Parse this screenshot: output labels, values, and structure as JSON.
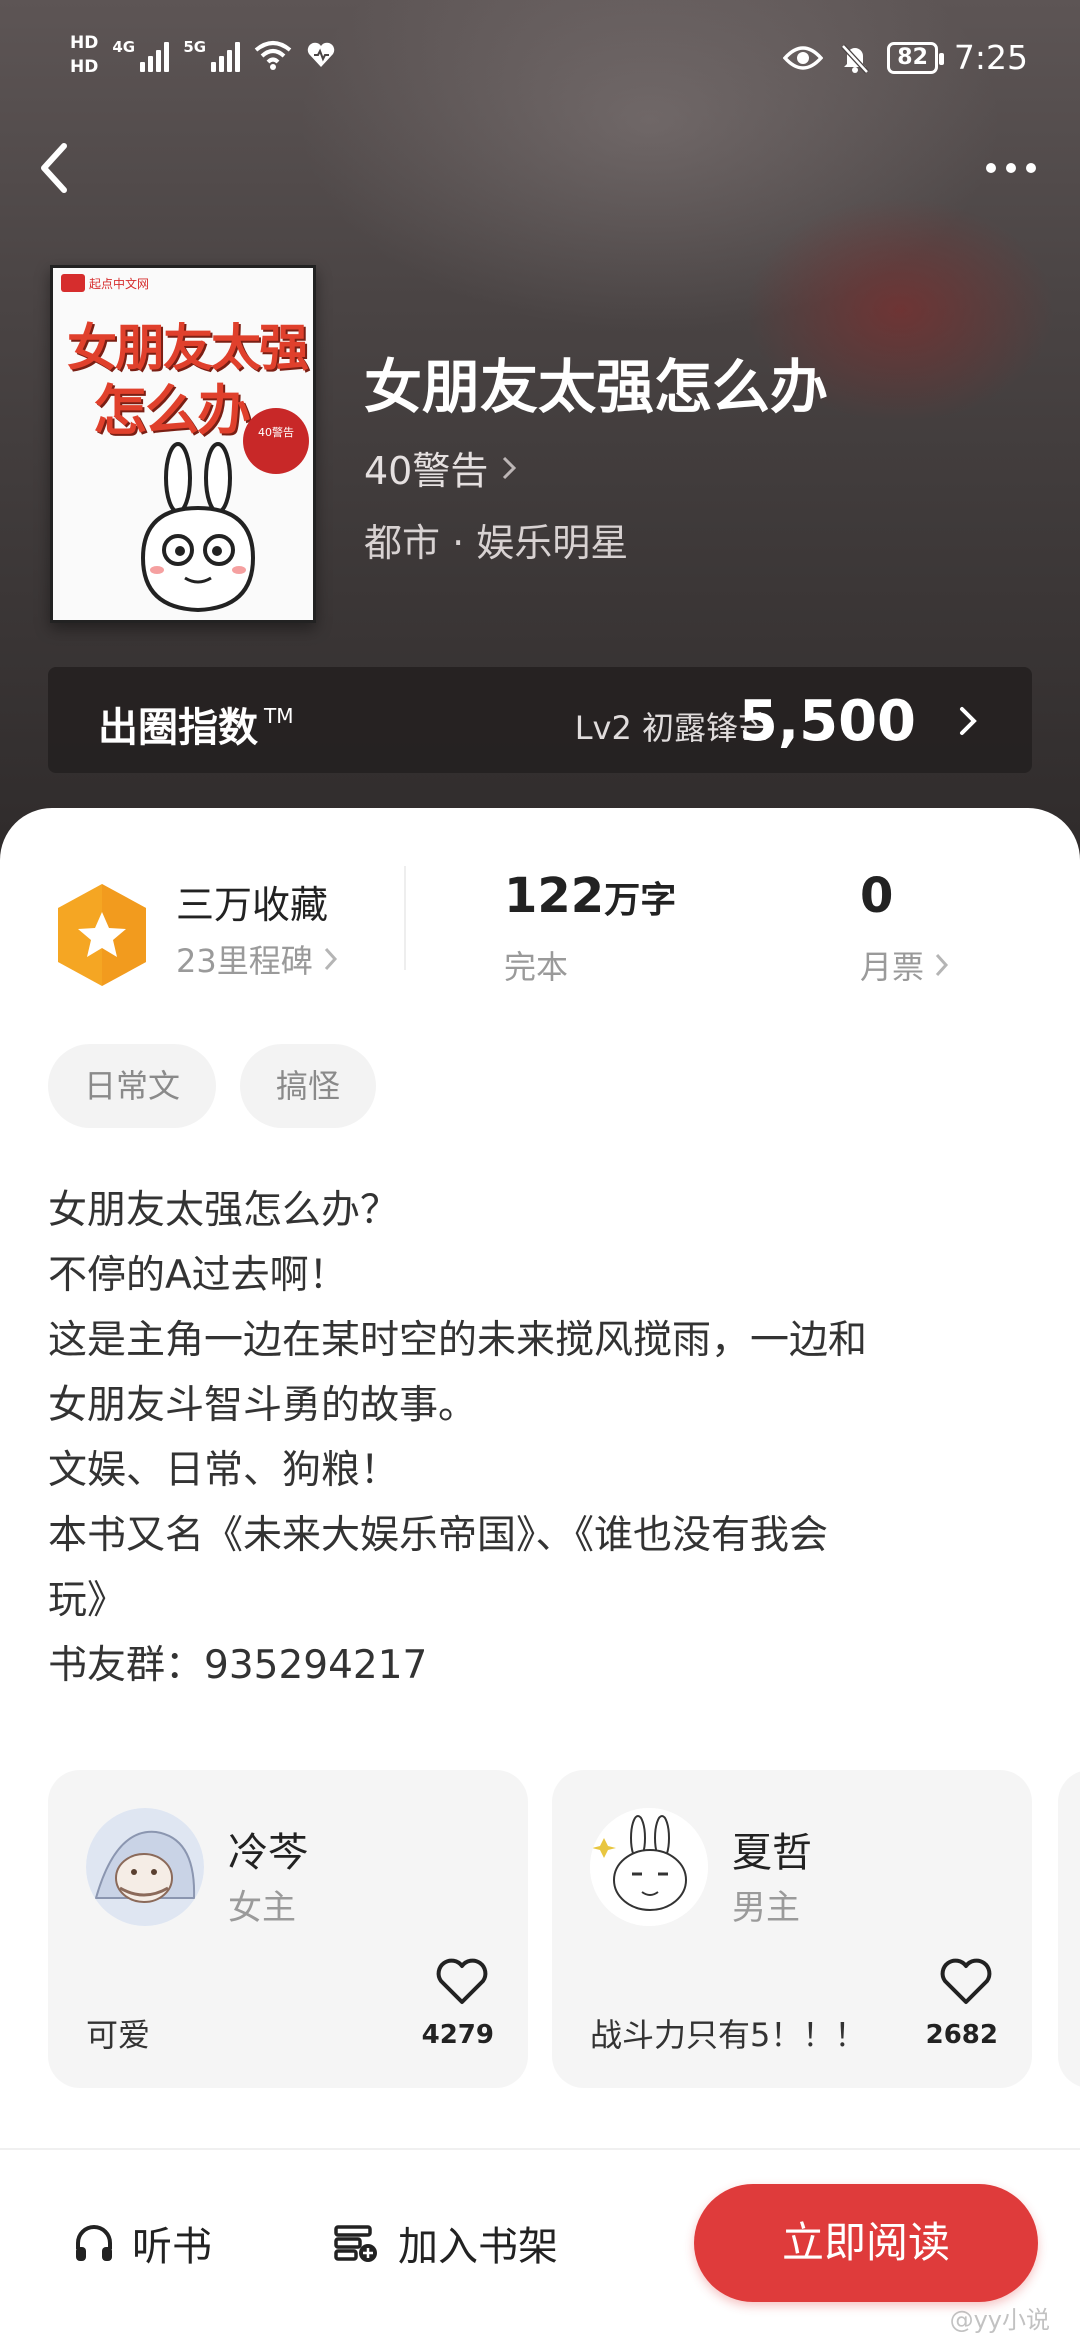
{
  "status_bar": {
    "hd1": "HD",
    "hd2": "HD",
    "net1": "4G",
    "net2": "5G",
    "battery": "82",
    "time": "7:25"
  },
  "book": {
    "title": "女朋友太强怎么办",
    "author": "40警告",
    "genre": "都市 · 娱乐明星",
    "cover": {
      "publisher": "起点中文网",
      "title_line1": "女朋友太强",
      "title_line2": "怎么办",
      "seal_text": "40警告"
    }
  },
  "index_bar": {
    "label": "出圈指数",
    "tm": "TM",
    "level": "Lv2 初露锋芒",
    "value": "5,500"
  },
  "stats": {
    "favorites": "三万收藏",
    "milestone": "23里程碑",
    "words_num": "122",
    "words_unit": "万字",
    "status": "完本",
    "tickets": "0",
    "tickets_label": "月票"
  },
  "tags": [
    "日常文",
    "搞怪"
  ],
  "intro": [
    "女朋友太强怎么办？",
    "不停的A过去啊！",
    "这是主角一边在某时空的未来搅风搅雨，一边和",
    "女朋友斗智斗勇的故事。",
    "文娱、日常、狗粮！",
    "本书又名《未来大娱乐帝国》、《谁也没有我会",
    "玩》",
    "书友群：935294217"
  ],
  "characters": [
    {
      "name": "冷芩",
      "role": "女主",
      "desc": "可爱",
      "likes": "4279"
    },
    {
      "name": "夏哲",
      "role": "男主",
      "desc": "战斗力只有5！！！",
      "likes": "2682"
    }
  ],
  "bottom_bar": {
    "listen": "听书",
    "add_shelf": "加入书架",
    "read_now": "立即阅读",
    "watermark": "@yy小说"
  },
  "colors": {
    "accent_red": "#df3b3b",
    "badge_orange": "#f5a623"
  }
}
